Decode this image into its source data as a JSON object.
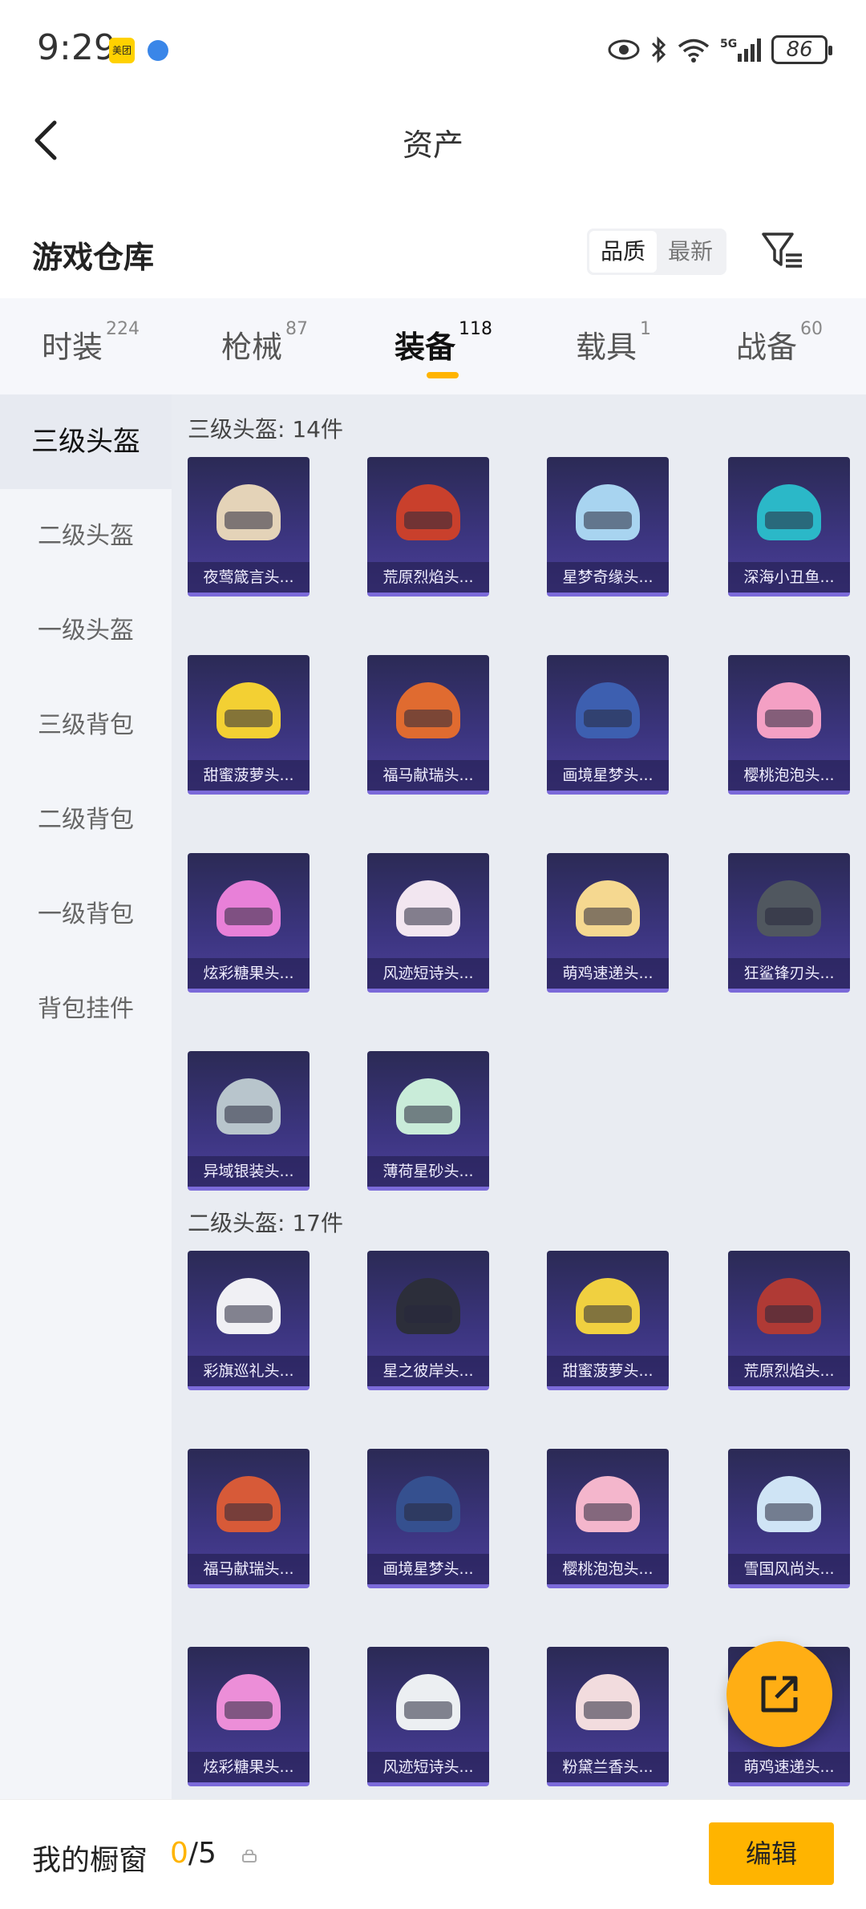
{
  "status_bar": {
    "time": "9:29",
    "app_badge": "美团",
    "battery": "86",
    "network": "5G"
  },
  "header": {
    "title": "资产"
  },
  "section": {
    "title": "游戏仓库",
    "sort_options": [
      "品质",
      "最新"
    ],
    "selected_sort": "品质"
  },
  "tabs": [
    {
      "label": "时装",
      "count": "224"
    },
    {
      "label": "枪械",
      "count": "87"
    },
    {
      "label": "装备",
      "count": "118"
    },
    {
      "label": "载具",
      "count": "1"
    },
    {
      "label": "战备",
      "count": "60"
    }
  ],
  "active_tab": "装备",
  "sidebar": {
    "items": [
      "三级头盔",
      "二级头盔",
      "一级头盔",
      "三级背包",
      "二级背包",
      "一级背包",
      "背包挂件"
    ],
    "active": "三级头盔"
  },
  "groups": [
    {
      "title": "三级头盔: 14件",
      "items": [
        "夜莺箴言头...",
        "荒原烈焰头...",
        "星梦奇缘头...",
        "深海小丑鱼...",
        "甜蜜菠萝头...",
        "福马献瑞头...",
        "画境星梦头...",
        "樱桃泡泡头...",
        "炫彩糖果头...",
        "风迹短诗头...",
        "萌鸡速递头...",
        "狂鲨锋刃头...",
        "异域银装头...",
        "薄荷星砂头..."
      ]
    },
    {
      "title": "二级头盔: 17件",
      "items": [
        "彩旗巡礼头...",
        "星之彼岸头...",
        "甜蜜菠萝头...",
        "荒原烈焰头...",
        "福马献瑞头...",
        "画境星梦头...",
        "樱桃泡泡头...",
        "雪国风尚头...",
        "炫彩糖果头...",
        "风迹短诗头...",
        "粉黛兰香头...",
        "萌鸡速递头..."
      ]
    }
  ],
  "colors": {
    "accent": "#ffb400",
    "helmets_g1": [
      "#e4d3b8",
      "#c9402c",
      "#a8d4f0",
      "#2bb8c8",
      "#f3d033",
      "#e06b30",
      "#3d5fb0",
      "#f4a0c4",
      "#e880d8",
      "#f2e6f0",
      "#f5d890",
      "#50575f",
      "#b8c5cc",
      "#c9ecd9"
    ],
    "helmets_g2": [
      "#f0f0f4",
      "#2c2e3a",
      "#f0d040",
      "#b03a35",
      "#d75a38",
      "#35508f",
      "#f4b6cc",
      "#cfe4f5",
      "#ec8ed8",
      "#eceff2",
      "#f2dcde",
      "#f5d890"
    ]
  },
  "bottom_bar": {
    "label": "我的橱窗",
    "current": "0",
    "total": "/5",
    "edit_label": "编辑"
  }
}
